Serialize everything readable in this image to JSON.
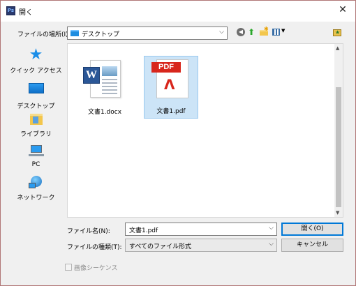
{
  "window": {
    "title": "開く",
    "app_icon_text": "Ps",
    "close_label": "✕"
  },
  "location": {
    "label": "ファイルの場所(I):",
    "current": "デスクトップ"
  },
  "sidebar": {
    "items": [
      {
        "label": "クイック アクセス",
        "icon": "star-icon"
      },
      {
        "label": "デスクトップ",
        "icon": "desktop-icon"
      },
      {
        "label": "ライブラリ",
        "icon": "library-icon"
      },
      {
        "label": "PC",
        "icon": "pc-icon"
      },
      {
        "label": "ネットワーク",
        "icon": "network-icon"
      }
    ]
  },
  "files": [
    {
      "name": "文書1.docx",
      "type": "word",
      "badge": "W",
      "selected": false
    },
    {
      "name": "文書1.pdf",
      "type": "pdf",
      "badge": "PDF",
      "selected": true
    }
  ],
  "filename": {
    "label": "ファイル名(N):",
    "value": "文書1.pdf"
  },
  "filetype": {
    "label": "ファイルの種類(T):",
    "value": "すべてのファイル形式"
  },
  "buttons": {
    "open": "開く(O)",
    "cancel": "キャンセル"
  },
  "sequence": {
    "label": "画像シーケンス",
    "checked": false,
    "enabled": false
  },
  "colors": {
    "accent": "#0078d7",
    "selection": "#cce4f7",
    "pdf_red": "#d8261c",
    "word_blue": "#2b5797"
  }
}
